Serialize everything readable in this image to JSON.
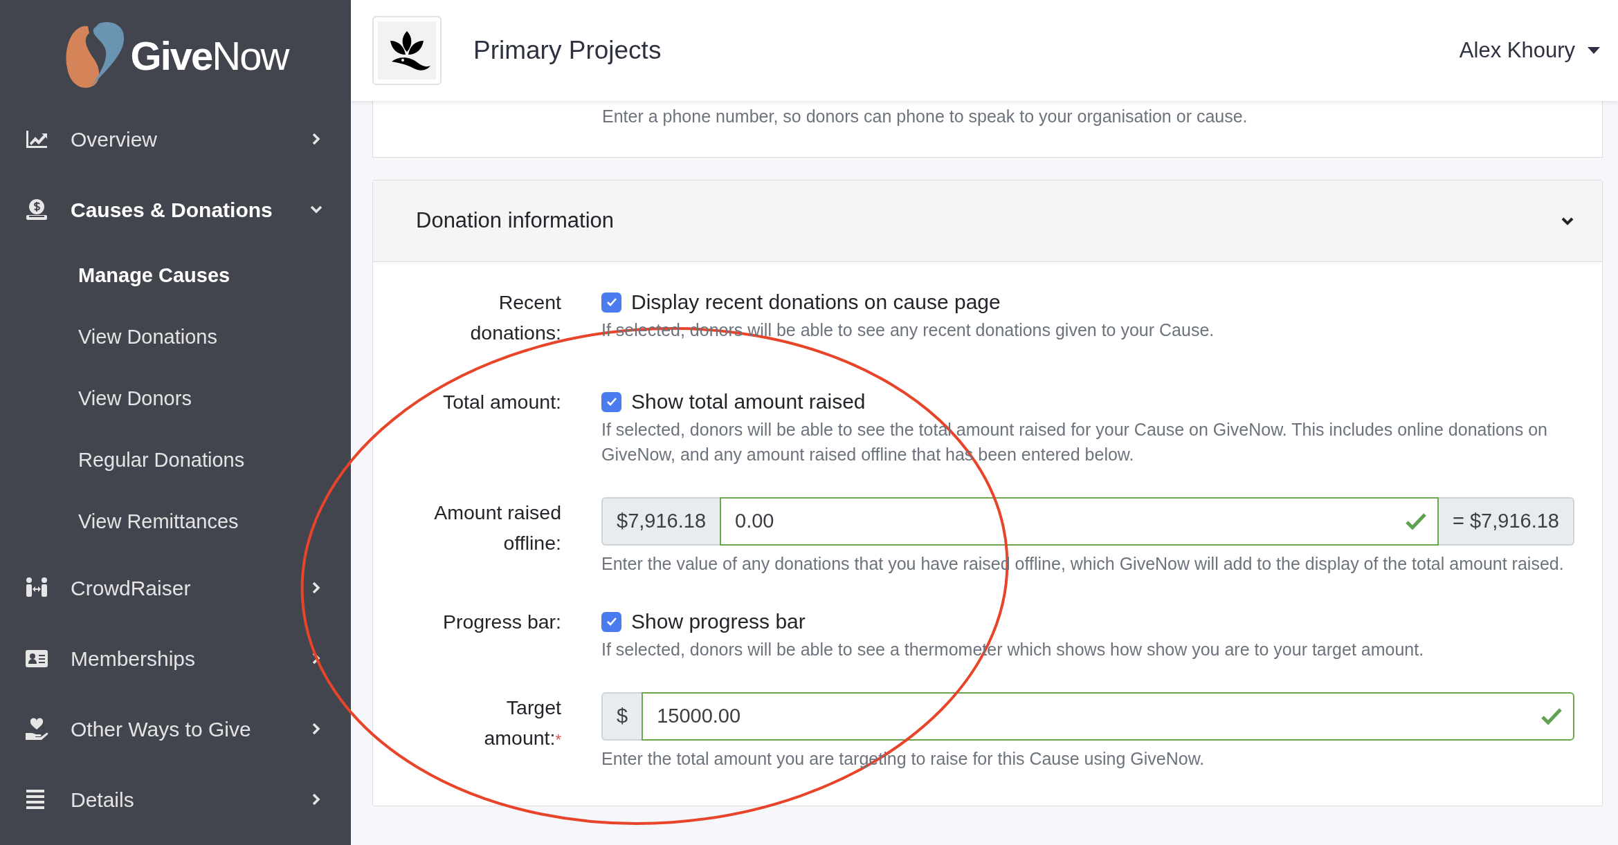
{
  "sidebar": {
    "logo": {
      "bold": "Give",
      "light": "Now"
    },
    "items": [
      {
        "label": "Overview",
        "selected": false,
        "expanded": false
      },
      {
        "label": "Causes & Donations",
        "selected": true,
        "expanded": true,
        "children": [
          {
            "label": "Manage Causes",
            "selected": true
          },
          {
            "label": "View Donations",
            "selected": false
          },
          {
            "label": "View Donors",
            "selected": false
          },
          {
            "label": "Regular Donations",
            "selected": false
          },
          {
            "label": "View Remittances",
            "selected": false
          }
        ]
      },
      {
        "label": "CrowdRaiser",
        "selected": false,
        "expanded": false
      },
      {
        "label": "Memberships",
        "selected": false,
        "expanded": false
      },
      {
        "label": "Other Ways to Give",
        "selected": false,
        "expanded": false
      },
      {
        "label": "Details",
        "selected": false,
        "expanded": false
      }
    ]
  },
  "header": {
    "organisation": "Primary Projects",
    "user": "Alex Khoury"
  },
  "previous_section": {
    "help": "Enter a phone number, so donors can phone to speak to your organisation or cause."
  },
  "donation_section": {
    "title": "Donation information",
    "expanded": true,
    "fields": [
      {
        "kind": "checkbox",
        "label": "Recent donations:",
        "option": "Display recent donations on cause page",
        "checked": true,
        "help": "If selected, donors will be able to see any recent donations given to your Cause."
      },
      {
        "kind": "checkbox",
        "label": "Total amount:",
        "option": "Show total amount raised",
        "checked": true,
        "help": "If selected, donors will be able to see the total amount raised for your Cause on GiveNow. This includes online donations on GiveNow, and any amount raised offline that has been entered below."
      },
      {
        "kind": "amount",
        "label": "Amount raised offline:",
        "prefix": "$7,916.18",
        "value": "0.00",
        "suffix": "= $7,916.18",
        "valid": true,
        "help": "Enter the value of any donations that you have raised offline, which GiveNow will add to the display of the total amount raised."
      },
      {
        "kind": "checkbox",
        "label": "Progress bar:",
        "option": "Show progress bar",
        "checked": true,
        "help": "If selected, donors will be able to see a thermometer which shows how show you are to your target amount."
      },
      {
        "kind": "amount",
        "label": "Target amount:",
        "required_mark": "*",
        "prefix": "$",
        "value": "15000.00",
        "valid": true,
        "help": "Enter the total amount you are targeting to raise for this Cause using GiveNow."
      }
    ]
  }
}
